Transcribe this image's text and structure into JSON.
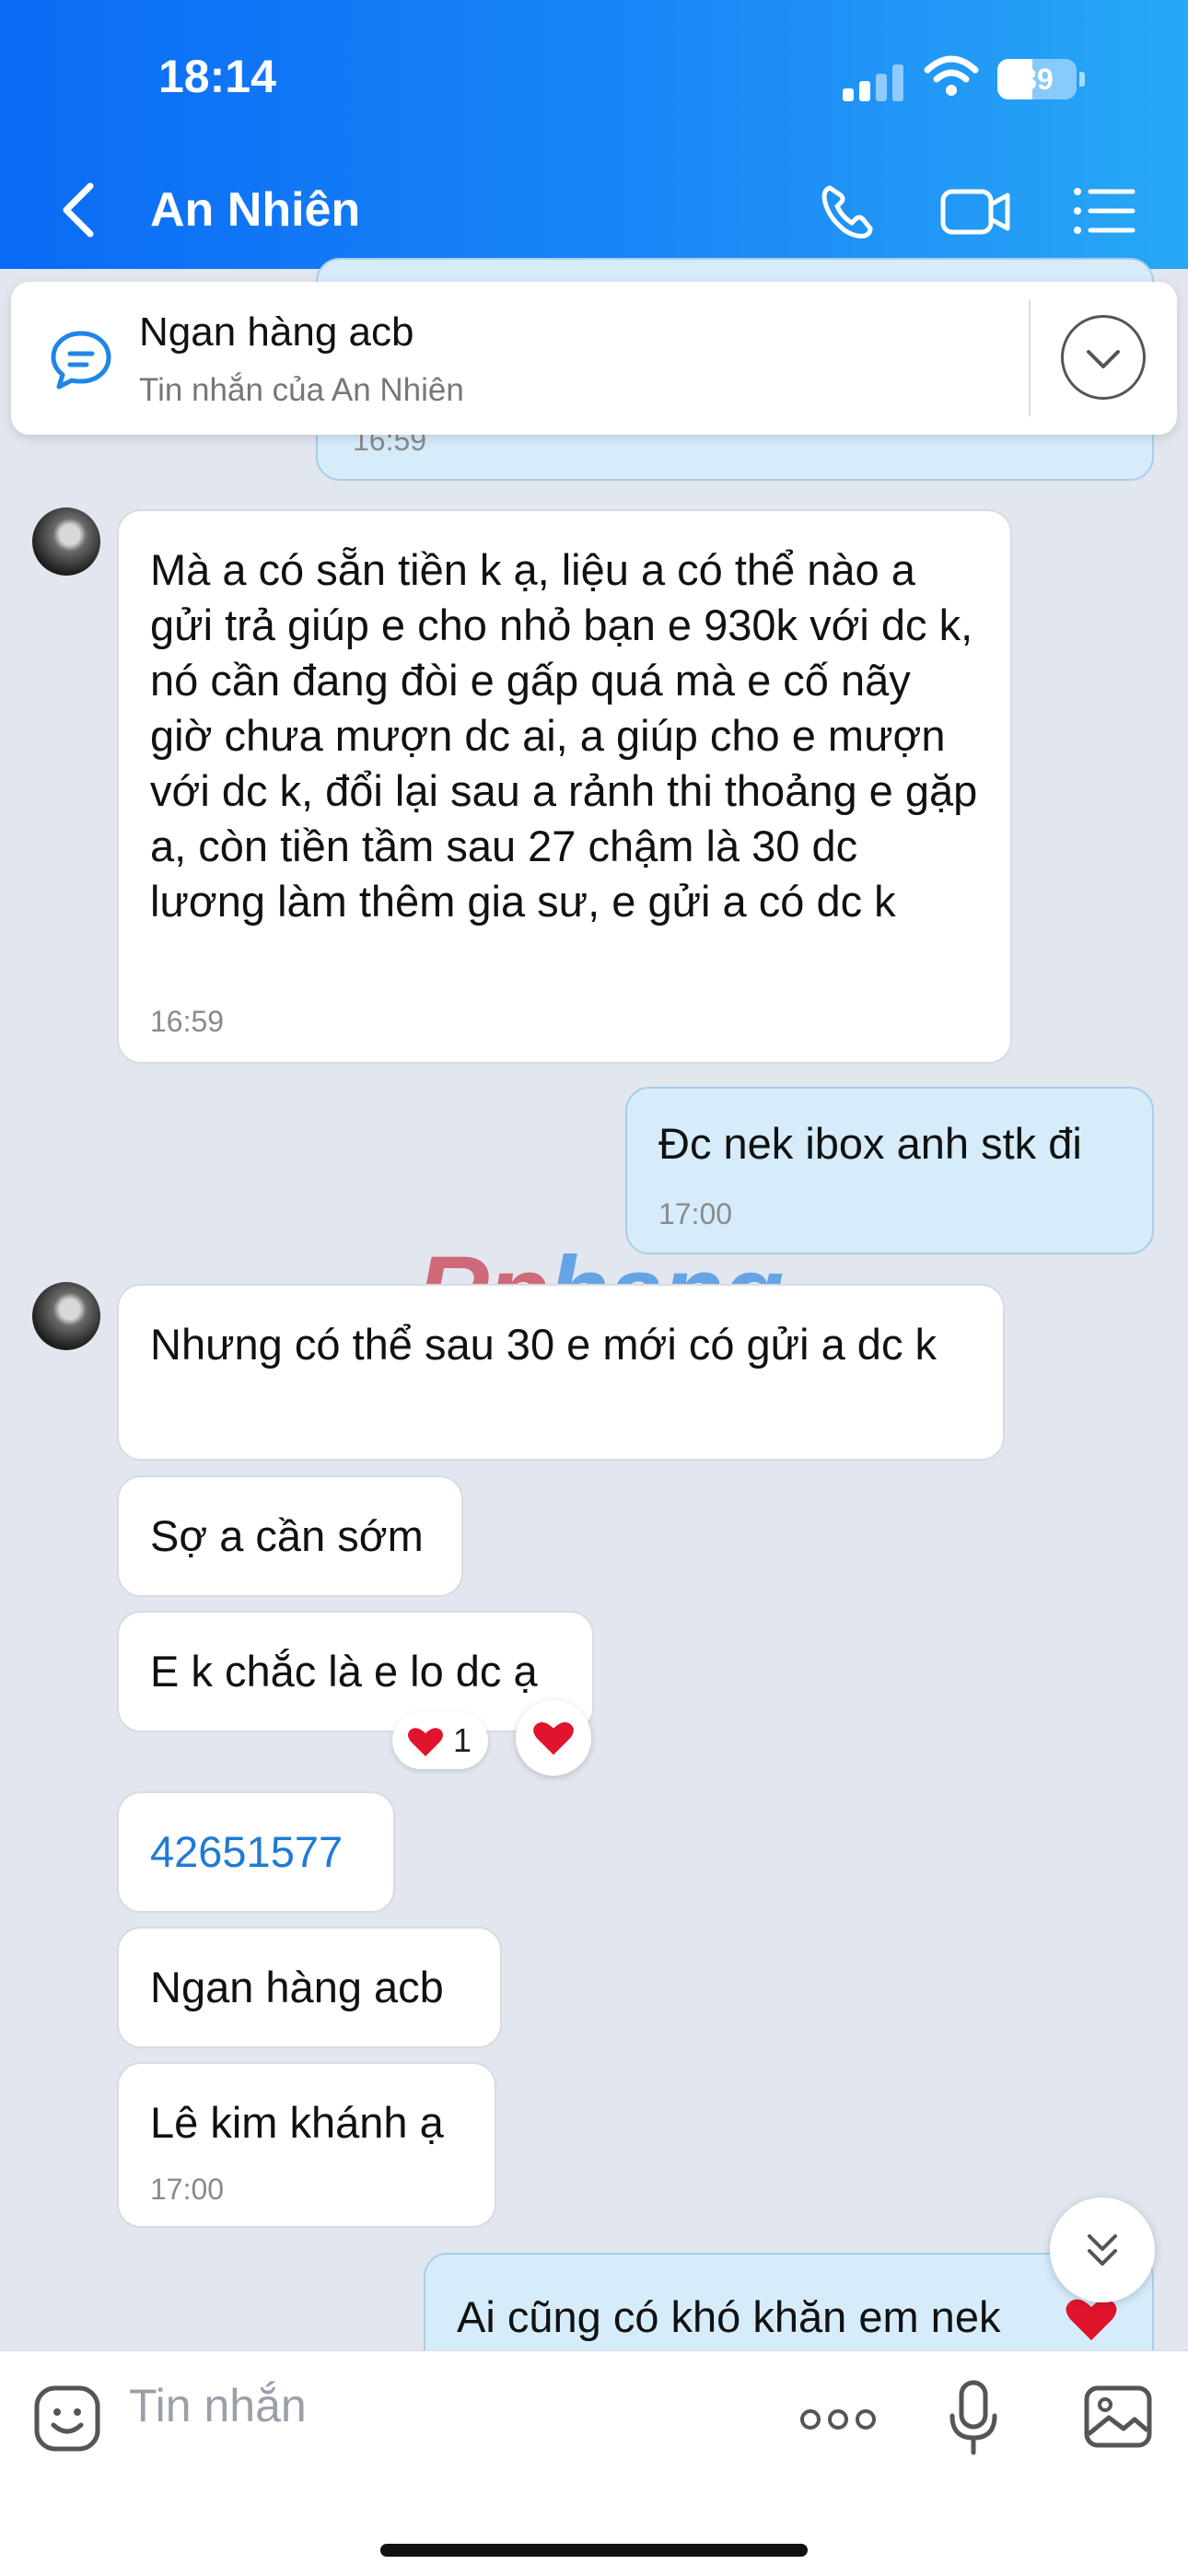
{
  "status_bar": {
    "time": "18:14",
    "battery": "39"
  },
  "header": {
    "title": "An Nhiên"
  },
  "pinned": {
    "title": "Ngan hàng acb",
    "subtitle": "Tin nhắn của An Nhiên"
  },
  "messages": [
    {
      "text": "Mà a có sẵn tiền k ạ, liệu a có thể nào a gửi trả giúp e cho nhỏ bạn e 930k với dc k, nó cần đang đòi e gấp quá mà e cố nãy giờ chưa mượn dc ai, a giúp cho e mượn với dc k, đổi lại sau a rảnh thi thoảng e gặp a, còn tiền tầm sau 27 chậm là 30 dc lương làm thêm gia sư, e gửi a có dc k",
      "time": "16:59"
    },
    {
      "text": "Đc nek ibox anh stk đi",
      "time": "17:00"
    },
    {
      "text": "Nhưng có thể sau 30 e mới có gửi a dc k"
    },
    {
      "text": "Sợ a cần sớm"
    },
    {
      "text": "E k chắc là e lo dc ạ",
      "reaction_count": "1"
    },
    {
      "text": "42651577"
    },
    {
      "text": "Ngan hàng acb"
    },
    {
      "text": "Lê kim khánh ạ",
      "time": "17:00"
    },
    {
      "text": "Ai cũng có khó khăn em nek"
    }
  ],
  "partial_time": "16:59",
  "watermark": {
    "part1": "Rp",
    "part2": "hang"
  },
  "input": {
    "placeholder": "Tin nhắn"
  },
  "colors": {
    "header_start": "#0a6bf5",
    "header_end": "#27a8f5",
    "outgoing_bubble": "#d6ecfb",
    "incoming_bubble": "#ffffff",
    "chat_bg": "#e2e6ee",
    "heart": "#e0142c"
  }
}
